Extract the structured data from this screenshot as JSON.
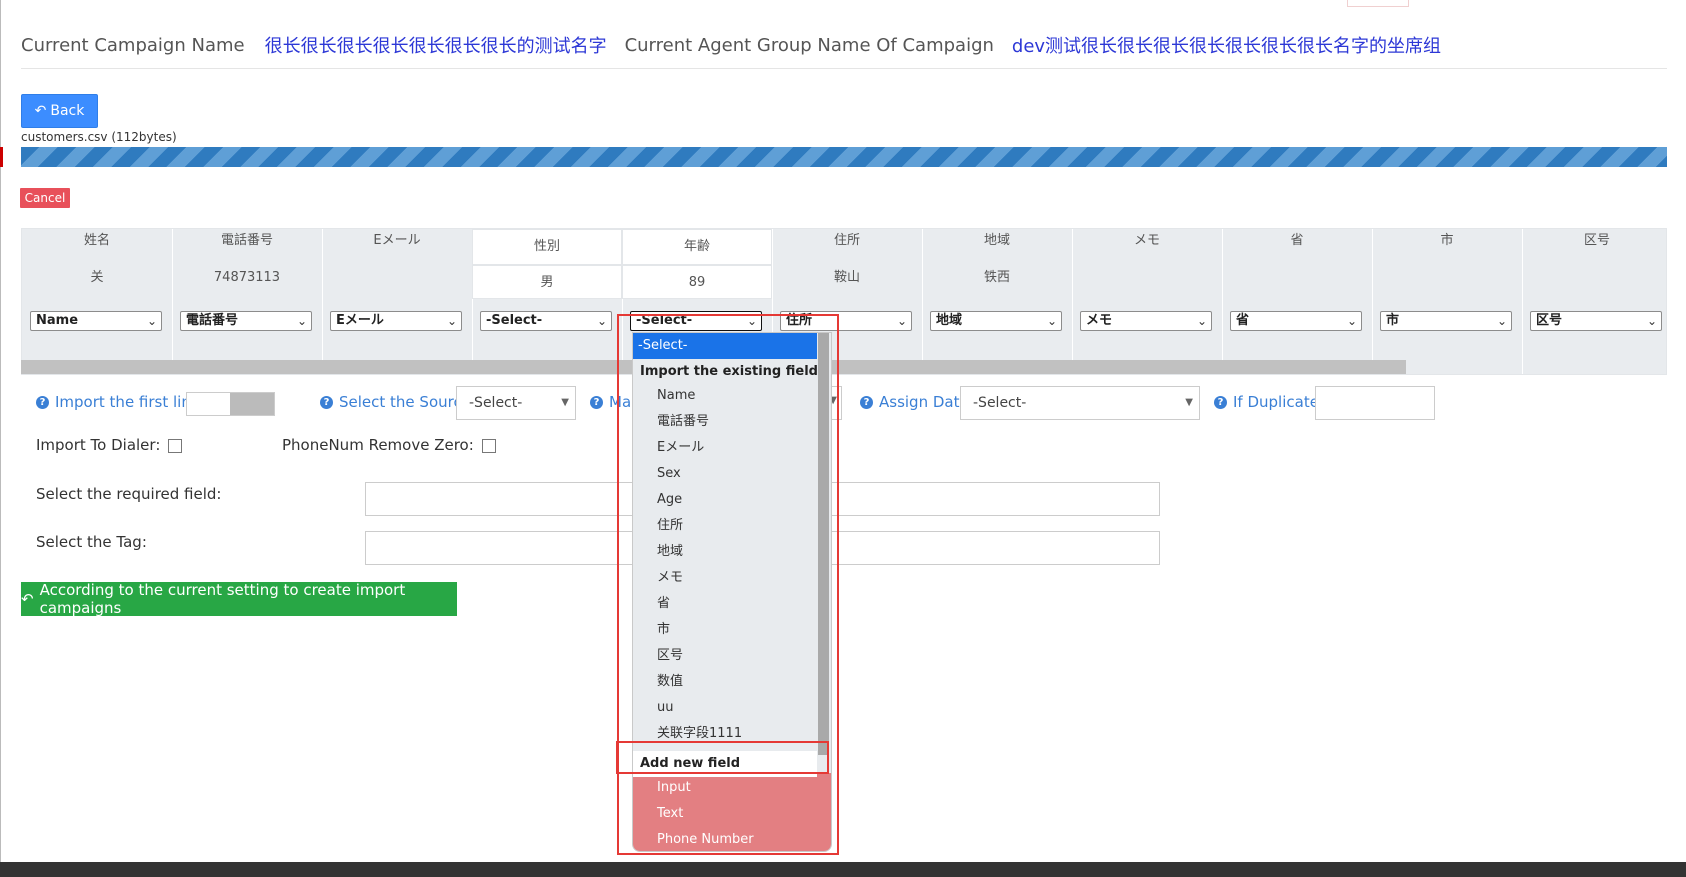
{
  "header": {
    "campaign_name_label": "Current Campaign Name",
    "campaign_name_value": "很长很长很长很长很长很长很长的测试名字",
    "agent_group_label": "Current Agent Group Name Of Campaign",
    "agent_group_value": "dev测试很长很长很长很长很长很长很长名字的坐席组"
  },
  "buttons": {
    "back": "Back",
    "cancel": "Cancel",
    "create": "According to the current setting to create import campaigns"
  },
  "upload": {
    "filename": "customers.csv (112bytes)",
    "progress_percent": 100
  },
  "columns": [
    {
      "header": "姓名",
      "value": "关",
      "select": "Name"
    },
    {
      "header": "電話番号",
      "value": "74873113",
      "select": "電話番号"
    },
    {
      "header": "Eメール",
      "value": "",
      "select": "Eメール"
    },
    {
      "header": "性別",
      "value": "男",
      "select": "-Select-"
    },
    {
      "header": "年齢",
      "value": "89",
      "select": "-Select-"
    },
    {
      "header": "住所",
      "value": "鞍山",
      "select": "住所"
    },
    {
      "header": "地域",
      "value": "铁西",
      "select": "地域"
    },
    {
      "header": "メモ",
      "value": "",
      "select": "メモ"
    },
    {
      "header": "省",
      "value": "",
      "select": "省"
    },
    {
      "header": "市",
      "value": "",
      "select": "市"
    },
    {
      "header": "区号",
      "value": "",
      "select": "区号"
    }
  ],
  "options": {
    "import_first_line": "Import the first line:",
    "select_source": "Select the Source:",
    "select_source_value": "-Select-",
    "match_partial": "Ma",
    "assign_data": "Assign Data:",
    "assign_data_value": "-Select-",
    "if_duplicate": "If Duplicate:",
    "import_to_dialer": "Import To Dialer:",
    "phonenum_remove_zero": "PhoneNum Remove Zero:",
    "required_field": "Select the required field:",
    "select_tag": "Select the Tag:"
  },
  "dropdown": {
    "selected": "-Select-",
    "group_existing": "Import the existing field",
    "existing_fields": [
      "Name",
      "電話番号",
      "Eメール",
      "Sex",
      "Age",
      "住所",
      "地域",
      "メモ",
      "省",
      "市",
      "区号",
      "数值",
      "uu",
      "关联字段1111"
    ],
    "group_new": "Add new field",
    "new_fields": [
      "Input",
      "Text",
      "Phone Number"
    ]
  },
  "icons": {
    "back": "reply-icon",
    "create": "reply-icon",
    "help": "question-circle-icon",
    "select": "chevron-down-icon"
  },
  "colors": {
    "primary": "#3c8dff",
    "danger": "#e8505a",
    "success": "#28a745",
    "link": "#2d38d6",
    "highlight": "#e53935"
  }
}
